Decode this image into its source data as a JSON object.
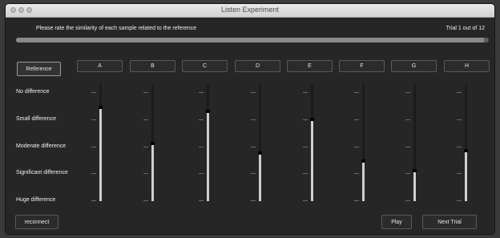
{
  "window": {
    "title": "Listen Experiment"
  },
  "header": {
    "instruction": "Please rate the similarity of each sample related to the reference",
    "trial": "Trial 1 out of 12"
  },
  "progress": {
    "fraction": 0.99
  },
  "reference_label": "Reference",
  "scale_labels": [
    "No difference",
    "Small difference",
    "Moderate difference",
    "Significant difference",
    "Huge difference"
  ],
  "samples": [
    {
      "label": "A",
      "rating": 0.8
    },
    {
      "label": "B",
      "rating": 0.49
    },
    {
      "label": "C",
      "rating": 0.77
    },
    {
      "label": "D",
      "rating": 0.41
    },
    {
      "label": "E",
      "rating": 0.7
    },
    {
      "label": "F",
      "rating": 0.34
    },
    {
      "label": "G",
      "rating": 0.26
    },
    {
      "label": "H",
      "rating": 0.43
    }
  ],
  "footer": {
    "reconnect_label": "reconnect",
    "play_label": "Play",
    "next_label": "Next Trial"
  },
  "colors": {
    "window_bg": "#262626",
    "slider_fill": "#cfcfcf",
    "slider_track": "#1b1b1b"
  }
}
